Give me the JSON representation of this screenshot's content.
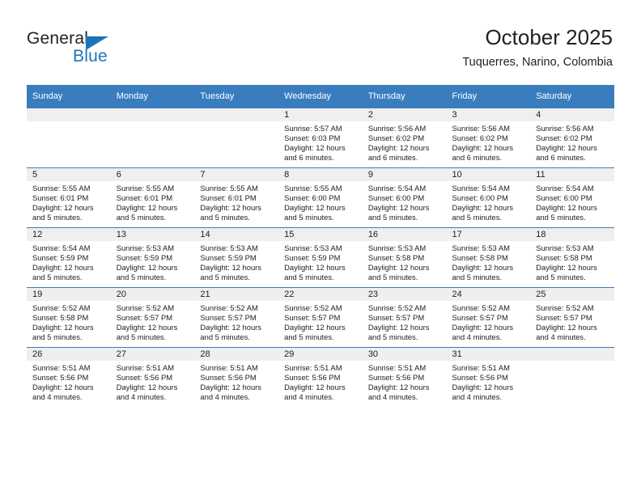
{
  "logo": {
    "word_one": "General",
    "word_two": "Blue",
    "triangle_color": "#1b74bb",
    "text_color": "#231f20"
  },
  "header": {
    "title": "October 2025",
    "subtitle": "Tuquerres, Narino, Colombia"
  },
  "theme": {
    "header_blue": "#3a7dbf",
    "day_band_gray": "#efefef",
    "text": "#222222",
    "page_background": "#ffffff"
  },
  "weekdays": [
    "Sunday",
    "Monday",
    "Tuesday",
    "Wednesday",
    "Thursday",
    "Friday",
    "Saturday"
  ],
  "weeks": [
    [
      {
        "day": "",
        "sunrise": "",
        "sunset": "",
        "daylight": "",
        "empty": true
      },
      {
        "day": "",
        "sunrise": "",
        "sunset": "",
        "daylight": "",
        "empty": true
      },
      {
        "day": "",
        "sunrise": "",
        "sunset": "",
        "daylight": "",
        "empty": true
      },
      {
        "day": "1",
        "sunrise": "Sunrise: 5:57 AM",
        "sunset": "Sunset: 6:03 PM",
        "daylight": "Daylight: 12 hours and 6 minutes.",
        "empty": false
      },
      {
        "day": "2",
        "sunrise": "Sunrise: 5:56 AM",
        "sunset": "Sunset: 6:02 PM",
        "daylight": "Daylight: 12 hours and 6 minutes.",
        "empty": false
      },
      {
        "day": "3",
        "sunrise": "Sunrise: 5:56 AM",
        "sunset": "Sunset: 6:02 PM",
        "daylight": "Daylight: 12 hours and 6 minutes.",
        "empty": false
      },
      {
        "day": "4",
        "sunrise": "Sunrise: 5:56 AM",
        "sunset": "Sunset: 6:02 PM",
        "daylight": "Daylight: 12 hours and 6 minutes.",
        "empty": false
      }
    ],
    [
      {
        "day": "5",
        "sunrise": "Sunrise: 5:55 AM",
        "sunset": "Sunset: 6:01 PM",
        "daylight": "Daylight: 12 hours and 5 minutes.",
        "empty": false
      },
      {
        "day": "6",
        "sunrise": "Sunrise: 5:55 AM",
        "sunset": "Sunset: 6:01 PM",
        "daylight": "Daylight: 12 hours and 5 minutes.",
        "empty": false
      },
      {
        "day": "7",
        "sunrise": "Sunrise: 5:55 AM",
        "sunset": "Sunset: 6:01 PM",
        "daylight": "Daylight: 12 hours and 5 minutes.",
        "empty": false
      },
      {
        "day": "8",
        "sunrise": "Sunrise: 5:55 AM",
        "sunset": "Sunset: 6:00 PM",
        "daylight": "Daylight: 12 hours and 5 minutes.",
        "empty": false
      },
      {
        "day": "9",
        "sunrise": "Sunrise: 5:54 AM",
        "sunset": "Sunset: 6:00 PM",
        "daylight": "Daylight: 12 hours and 5 minutes.",
        "empty": false
      },
      {
        "day": "10",
        "sunrise": "Sunrise: 5:54 AM",
        "sunset": "Sunset: 6:00 PM",
        "daylight": "Daylight: 12 hours and 5 minutes.",
        "empty": false
      },
      {
        "day": "11",
        "sunrise": "Sunrise: 5:54 AM",
        "sunset": "Sunset: 6:00 PM",
        "daylight": "Daylight: 12 hours and 5 minutes.",
        "empty": false
      }
    ],
    [
      {
        "day": "12",
        "sunrise": "Sunrise: 5:54 AM",
        "sunset": "Sunset: 5:59 PM",
        "daylight": "Daylight: 12 hours and 5 minutes.",
        "empty": false
      },
      {
        "day": "13",
        "sunrise": "Sunrise: 5:53 AM",
        "sunset": "Sunset: 5:59 PM",
        "daylight": "Daylight: 12 hours and 5 minutes.",
        "empty": false
      },
      {
        "day": "14",
        "sunrise": "Sunrise: 5:53 AM",
        "sunset": "Sunset: 5:59 PM",
        "daylight": "Daylight: 12 hours and 5 minutes.",
        "empty": false
      },
      {
        "day": "15",
        "sunrise": "Sunrise: 5:53 AM",
        "sunset": "Sunset: 5:59 PM",
        "daylight": "Daylight: 12 hours and 5 minutes.",
        "empty": false
      },
      {
        "day": "16",
        "sunrise": "Sunrise: 5:53 AM",
        "sunset": "Sunset: 5:58 PM",
        "daylight": "Daylight: 12 hours and 5 minutes.",
        "empty": false
      },
      {
        "day": "17",
        "sunrise": "Sunrise: 5:53 AM",
        "sunset": "Sunset: 5:58 PM",
        "daylight": "Daylight: 12 hours and 5 minutes.",
        "empty": false
      },
      {
        "day": "18",
        "sunrise": "Sunrise: 5:53 AM",
        "sunset": "Sunset: 5:58 PM",
        "daylight": "Daylight: 12 hours and 5 minutes.",
        "empty": false
      }
    ],
    [
      {
        "day": "19",
        "sunrise": "Sunrise: 5:52 AM",
        "sunset": "Sunset: 5:58 PM",
        "daylight": "Daylight: 12 hours and 5 minutes.",
        "empty": false
      },
      {
        "day": "20",
        "sunrise": "Sunrise: 5:52 AM",
        "sunset": "Sunset: 5:57 PM",
        "daylight": "Daylight: 12 hours and 5 minutes.",
        "empty": false
      },
      {
        "day": "21",
        "sunrise": "Sunrise: 5:52 AM",
        "sunset": "Sunset: 5:57 PM",
        "daylight": "Daylight: 12 hours and 5 minutes.",
        "empty": false
      },
      {
        "day": "22",
        "sunrise": "Sunrise: 5:52 AM",
        "sunset": "Sunset: 5:57 PM",
        "daylight": "Daylight: 12 hours and 5 minutes.",
        "empty": false
      },
      {
        "day": "23",
        "sunrise": "Sunrise: 5:52 AM",
        "sunset": "Sunset: 5:57 PM",
        "daylight": "Daylight: 12 hours and 5 minutes.",
        "empty": false
      },
      {
        "day": "24",
        "sunrise": "Sunrise: 5:52 AM",
        "sunset": "Sunset: 5:57 PM",
        "daylight": "Daylight: 12 hours and 4 minutes.",
        "empty": false
      },
      {
        "day": "25",
        "sunrise": "Sunrise: 5:52 AM",
        "sunset": "Sunset: 5:57 PM",
        "daylight": "Daylight: 12 hours and 4 minutes.",
        "empty": false
      }
    ],
    [
      {
        "day": "26",
        "sunrise": "Sunrise: 5:51 AM",
        "sunset": "Sunset: 5:56 PM",
        "daylight": "Daylight: 12 hours and 4 minutes.",
        "empty": false
      },
      {
        "day": "27",
        "sunrise": "Sunrise: 5:51 AM",
        "sunset": "Sunset: 5:56 PM",
        "daylight": "Daylight: 12 hours and 4 minutes.",
        "empty": false
      },
      {
        "day": "28",
        "sunrise": "Sunrise: 5:51 AM",
        "sunset": "Sunset: 5:56 PM",
        "daylight": "Daylight: 12 hours and 4 minutes.",
        "empty": false
      },
      {
        "day": "29",
        "sunrise": "Sunrise: 5:51 AM",
        "sunset": "Sunset: 5:56 PM",
        "daylight": "Daylight: 12 hours and 4 minutes.",
        "empty": false
      },
      {
        "day": "30",
        "sunrise": "Sunrise: 5:51 AM",
        "sunset": "Sunset: 5:56 PM",
        "daylight": "Daylight: 12 hours and 4 minutes.",
        "empty": false
      },
      {
        "day": "31",
        "sunrise": "Sunrise: 5:51 AM",
        "sunset": "Sunset: 5:56 PM",
        "daylight": "Daylight: 12 hours and 4 minutes.",
        "empty": false
      },
      {
        "day": "",
        "sunrise": "",
        "sunset": "",
        "daylight": "",
        "empty": true
      }
    ]
  ]
}
